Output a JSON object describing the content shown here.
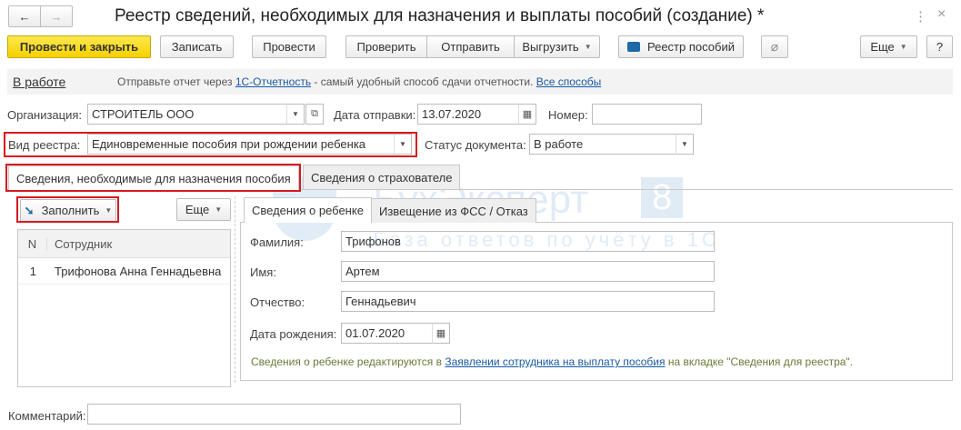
{
  "window": {
    "title": "Реестр сведений, необходимых для назначения и выплаты пособий (создание) *",
    "more_icon": "⋮",
    "close_icon": "×"
  },
  "nav": {
    "back": "←",
    "forward": "→"
  },
  "toolbar": {
    "post_close": "Провести и закрыть",
    "save": "Записать",
    "post": "Провести",
    "check": "Проверить",
    "send": "Отправить",
    "export": "Выгрузить",
    "registry": "Реестр пособий",
    "more": "Еще",
    "help": "?"
  },
  "infobar": {
    "status_link": "В работе",
    "text_before": "Отправьте отчет через ",
    "link1": "1С-Отчетность",
    "text_after": " - самый удобный способ сдачи отчетности. ",
    "link2": "Все способы"
  },
  "form": {
    "org_label": "Организация:",
    "org_value": "СТРОИТЕЛЬ ООО",
    "date_label": "Дата отправки:",
    "date_value": "13.07.2020",
    "number_label": "Номер:",
    "number_value": "",
    "registry_type_label": "Вид реестра:",
    "registry_type_value": "Единовременные пособия при рождении ребенка",
    "doc_status_label": "Статус документа:",
    "doc_status_value": "В работе",
    "comment_label": "Комментарий:",
    "comment_value": ""
  },
  "tabs": [
    "Сведения, необходимые для назначения пособия",
    "Сведения о страхователе"
  ],
  "left": {
    "fill": "Заполнить",
    "more": "Еще",
    "columns": [
      "N",
      "Сотрудник"
    ],
    "rows": [
      {
        "n": "1",
        "name": "Трифонова Анна Геннадьевна"
      }
    ]
  },
  "right": {
    "tabs": [
      "Сведения о ребенке",
      "Извещение из ФСС / Отказ"
    ],
    "surname_label": "Фамилия:",
    "surname": "Трифонов",
    "name_label": "Имя:",
    "name": "Артем",
    "patronymic_label": "Отчество:",
    "patronymic": "Геннадьевич",
    "birth_label": "Дата рождения:",
    "birth": "01.07.2020",
    "note_before": "Сведения о ребенке редактируются в ",
    "note_link": "Заявлении сотрудника на выплату пособия",
    "note_after": " на вкладке \"Сведения для реестра\"."
  },
  "watermark": {
    "brand": "БухЭксперт",
    "num": "8",
    "tagline": "База ответов по учёту в 1С"
  }
}
